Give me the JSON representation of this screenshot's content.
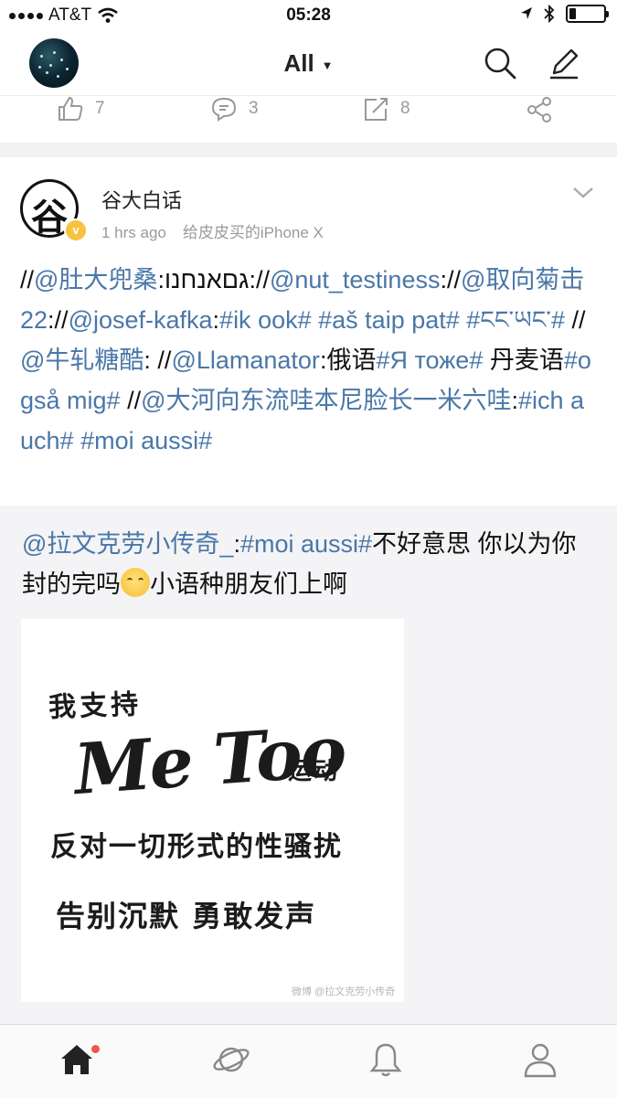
{
  "status_bar": {
    "carrier": "AT&T",
    "time": "05:28",
    "battery_level": 0.2
  },
  "nav": {
    "title": "All",
    "icons": [
      "avatar",
      "caret-down-icon",
      "search-icon",
      "compose-icon"
    ]
  },
  "previous_post_actions": {
    "like_count": "7",
    "comment_count": "3",
    "repost_count": "8"
  },
  "post": {
    "author": "谷大白话",
    "avatar_glyph": "谷",
    "verified_mark": "v",
    "time": "1 hrs ago",
    "source": "给皮皮买的iPhone X",
    "body": [
      {
        "type": "text",
        "text": "//"
      },
      {
        "type": "mention",
        "text": "@肚大兜桑"
      },
      {
        "type": "text",
        "text": ":גםאנחנו://"
      },
      {
        "type": "mention",
        "text": "@nut_testiness"
      },
      {
        "type": "text",
        "text": "://"
      },
      {
        "type": "mention",
        "text": "@取向菊击22"
      },
      {
        "type": "text",
        "text": "://"
      },
      {
        "type": "mention",
        "text": "@josef-kafka"
      },
      {
        "type": "text",
        "text": ":"
      },
      {
        "type": "tag",
        "text": "#ik ook#"
      },
      {
        "type": "text",
        "text": " "
      },
      {
        "type": "tag",
        "text": "#aš taip pat#"
      },
      {
        "type": "text",
        "text": " "
      },
      {
        "type": "tag",
        "text": "#ངང་ཡང་#"
      },
      {
        "type": "text",
        "text": " //"
      },
      {
        "type": "mention",
        "text": "@牛轧糖酷"
      },
      {
        "type": "text",
        "text": ": //"
      },
      {
        "type": "mention",
        "text": "@Llamanator"
      },
      {
        "type": "text",
        "text": ":俄语"
      },
      {
        "type": "tag",
        "text": "#Я тоже#"
      },
      {
        "type": "text",
        "text": " 丹麦语"
      },
      {
        "type": "tag",
        "text": "#også mig#"
      },
      {
        "type": "text",
        "text": " //"
      },
      {
        "type": "mention",
        "text": "@大河向东流哇本尼脸长一米六哇"
      },
      {
        "type": "text",
        "text": ":"
      },
      {
        "type": "tag",
        "text": "#ich auch#"
      },
      {
        "type": "text",
        "text": " "
      },
      {
        "type": "tag",
        "text": "#moi aussi#"
      }
    ]
  },
  "repost": {
    "body": [
      {
        "type": "mention",
        "text": "@拉文克劳小传奇_"
      },
      {
        "type": "text",
        "text": ":"
      },
      {
        "type": "tag",
        "text": "#moi aussi#"
      },
      {
        "type": "text",
        "text": "不好意思 你以为你封的完吗"
      },
      {
        "type": "emoji",
        "text": ""
      },
      {
        "type": "text",
        "text": "小语种朋友们上啊"
      }
    ],
    "image": {
      "line1": "我支持",
      "line2": "Me Too",
      "line3": "运动",
      "line4": "反对一切形式的性骚扰",
      "line5": "告别沉默 勇敢发声",
      "watermark": "微博 @拉文克劳小传奇"
    }
  },
  "tab_bar": {
    "tabs": [
      "home-icon",
      "discover-icon",
      "notifications-icon",
      "profile-icon"
    ],
    "active": "home-icon",
    "colors": {
      "active": "#222222",
      "inactive": "#888888",
      "badge": "#f25545"
    }
  },
  "colors": {
    "link": "#4a77a8",
    "meta": "#9a9a9a",
    "verified": "#f7c23e"
  }
}
